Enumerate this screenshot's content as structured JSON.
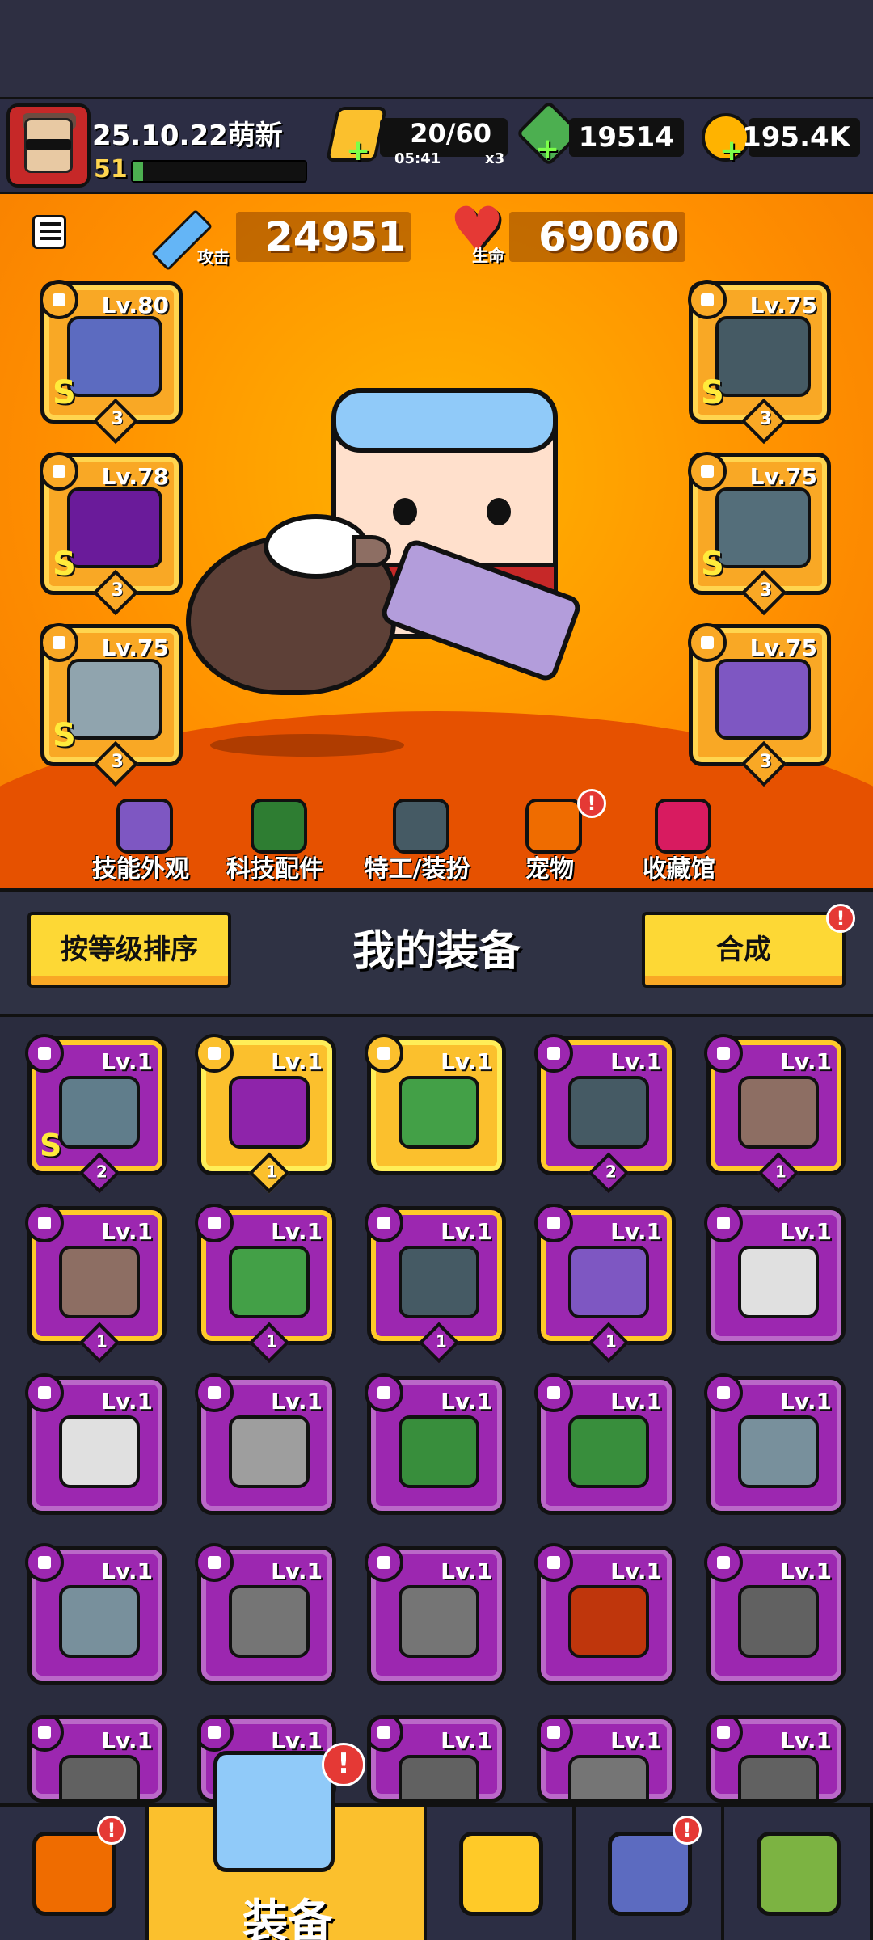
{
  "player": {
    "name": "25.10.22萌新",
    "level": "51",
    "xp_fraction": 0.06
  },
  "resources": {
    "energy": {
      "value": "20/60",
      "timer": "05:41",
      "multiplier": "x3",
      "icon": "energy-icon"
    },
    "gems": {
      "value": "19514",
      "icon": "gem-icon"
    },
    "coins": {
      "value": "195.4K",
      "icon": "coin-icon"
    }
  },
  "stats": {
    "attack": {
      "label": "攻击",
      "value": "24951"
    },
    "health": {
      "label": "生命",
      "value": "69060"
    }
  },
  "equipped": [
    {
      "slot": "weapon",
      "level": "Lv.80",
      "rank": "S",
      "stars": "3",
      "color": "#5c6bc0"
    },
    {
      "slot": "necklace",
      "level": "Lv.78",
      "rank": "S",
      "stars": "3",
      "color": "#6a1b9a"
    },
    {
      "slot": "gloves",
      "level": "Lv.75",
      "rank": "S",
      "stars": "3",
      "color": "#90a4ae"
    },
    {
      "slot": "armor",
      "level": "Lv.75",
      "rank": "S",
      "stars": "3",
      "color": "#455a64"
    },
    {
      "slot": "belt",
      "level": "Lv.75",
      "rank": "S",
      "stars": "3",
      "color": "#546e7a"
    },
    {
      "slot": "boots",
      "level": "Lv.75",
      "rank": "",
      "stars": "3",
      "color": "#7e57c2"
    }
  ],
  "shortcuts": [
    {
      "label": "技能外观",
      "icon": "skill-skin-icon",
      "color": "#7e57c2",
      "badge": ""
    },
    {
      "label": "科技配件",
      "icon": "tech-part-icon",
      "color": "#2e7d32",
      "badge": ""
    },
    {
      "label": "特工/装扮",
      "icon": "agent-icon",
      "color": "#455a64",
      "badge": ""
    },
    {
      "label": "宠物",
      "icon": "pet-icon",
      "color": "#ef6c00",
      "badge": "!"
    },
    {
      "label": "收藏馆",
      "icon": "collection-icon",
      "color": "#d81b60",
      "badge": ""
    }
  ],
  "panel": {
    "title": "我的装备",
    "sort_label": "按等级排序",
    "merge_label": "合成",
    "merge_badge": "!"
  },
  "inventory": [
    {
      "level": "Lv.1",
      "rank": "S",
      "stars": "2",
      "tier": "purple-gold",
      "item": "armor",
      "color": "#607d8b"
    },
    {
      "level": "Lv.1",
      "rank": "",
      "stars": "1",
      "tier": "gold",
      "item": "gloves",
      "color": "#8e24aa"
    },
    {
      "level": "Lv.1",
      "rank": "",
      "stars": "",
      "tier": "gold",
      "item": "necklace",
      "color": "#43a047"
    },
    {
      "level": "Lv.1",
      "rank": "",
      "stars": "2",
      "tier": "purple-gold",
      "item": "belt",
      "color": "#455a64"
    },
    {
      "level": "Lv.1",
      "rank": "",
      "stars": "1",
      "tier": "purple-gold",
      "item": "shotgun",
      "color": "#8d6e63"
    },
    {
      "level": "Lv.1",
      "rank": "",
      "stars": "1",
      "tier": "purple-gold",
      "item": "shotgun",
      "color": "#8d6e63"
    },
    {
      "level": "Lv.1",
      "rank": "",
      "stars": "1",
      "tier": "purple-gold",
      "item": "necklace",
      "color": "#43a047"
    },
    {
      "level": "Lv.1",
      "rank": "",
      "stars": "1",
      "tier": "purple-gold",
      "item": "belt",
      "color": "#455a64"
    },
    {
      "level": "Lv.1",
      "rank": "",
      "stars": "1",
      "tier": "purple-gold",
      "item": "boots",
      "color": "#7e57c2"
    },
    {
      "level": "Lv.1",
      "rank": "",
      "stars": "",
      "tier": "purple",
      "item": "katana",
      "color": "#e0e0e0"
    },
    {
      "level": "Lv.1",
      "rank": "",
      "stars": "",
      "tier": "purple",
      "item": "katana",
      "color": "#e0e0e0"
    },
    {
      "level": "Lv.1",
      "rank": "",
      "stars": "",
      "tier": "purple",
      "item": "revolver",
      "color": "#9e9e9e"
    },
    {
      "level": "Lv.1",
      "rank": "",
      "stars": "",
      "tier": "purple",
      "item": "armor",
      "color": "#388e3c"
    },
    {
      "level": "Lv.1",
      "rank": "",
      "stars": "",
      "tier": "purple",
      "item": "armor",
      "color": "#388e3c"
    },
    {
      "level": "Lv.1",
      "rank": "",
      "stars": "",
      "tier": "purple",
      "item": "armor",
      "color": "#78909c"
    },
    {
      "level": "Lv.1",
      "rank": "",
      "stars": "",
      "tier": "purple",
      "item": "armor",
      "color": "#78909c"
    },
    {
      "level": "Lv.1",
      "rank": "",
      "stars": "",
      "tier": "purple",
      "item": "armor",
      "color": "#757575"
    },
    {
      "level": "Lv.1",
      "rank": "",
      "stars": "",
      "tier": "purple",
      "item": "armor",
      "color": "#757575"
    },
    {
      "level": "Lv.1",
      "rank": "",
      "stars": "",
      "tier": "purple",
      "item": "necklace",
      "color": "#bf360c"
    },
    {
      "level": "Lv.1",
      "rank": "",
      "stars": "",
      "tier": "purple",
      "item": "necklace",
      "color": "#616161"
    },
    {
      "level": "Lv.1",
      "rank": "",
      "stars": "",
      "tier": "purple",
      "item": "necklace",
      "color": "#616161"
    },
    {
      "level": "Lv.1",
      "rank": "",
      "stars": "",
      "tier": "purple",
      "item": "necklace",
      "color": "#616161"
    },
    {
      "level": "Lv.1",
      "rank": "",
      "stars": "",
      "tier": "purple",
      "item": "necklace",
      "color": "#616161"
    },
    {
      "level": "Lv.1",
      "rank": "",
      "stars": "",
      "tier": "purple",
      "item": "necklace",
      "color": "#757575"
    },
    {
      "level": "Lv.1",
      "rank": "",
      "stars": "",
      "tier": "purple",
      "item": "necklace",
      "color": "#616161"
    }
  ],
  "nav": {
    "active_label": "装备",
    "tabs": [
      {
        "name": "shop",
        "icon": "shop-icon",
        "badge": "!"
      },
      {
        "name": "equipment",
        "icon": "equipment-icon",
        "badge": "!"
      },
      {
        "name": "battle",
        "icon": "battle-star-icon",
        "badge": ""
      },
      {
        "name": "planet",
        "icon": "planet-icon",
        "badge": "!"
      },
      {
        "name": "gene",
        "icon": "dna-battery-icon",
        "badge": ""
      }
    ]
  },
  "colors": {
    "accent": "#fbc02d",
    "epic": "#9c27b0",
    "hero_bg": "#ff8f00"
  }
}
